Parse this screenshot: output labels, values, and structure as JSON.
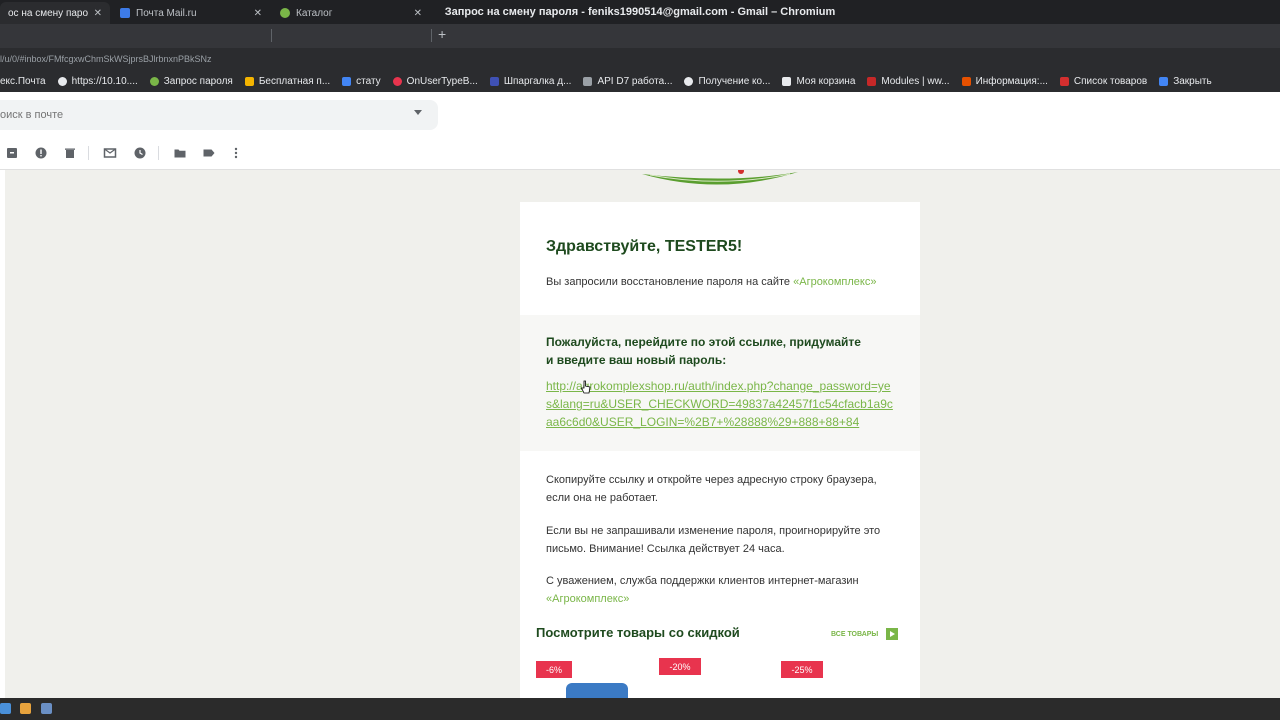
{
  "window": {
    "title": "Запрос на смену пароля - feniks1990514@gmail.com - Gmail – Chromium"
  },
  "tabs": [
    {
      "label": "ос на смену пароля",
      "close": "✕",
      "favicon_color": "#ffffff",
      "active": true
    },
    {
      "label": "Почта Mail.ru",
      "close": "✕",
      "favicon_color": "#3d7be8"
    },
    {
      "label": "Каталог",
      "close": "✕",
      "favicon_color": "#7ab648"
    }
  ],
  "new_tab_symbol": "+",
  "address": {
    "url": "l/u/0/#inbox/FMfcgxwChmSkWSjprsBJlrbnxnPBkSNz"
  },
  "bookmarks": [
    {
      "label": "екс.Почта",
      "icon_color": "#e8eaed"
    },
    {
      "label": "https://10.10....",
      "icon_color": "#e8eaed"
    },
    {
      "label": "Запрос пароля",
      "icon_color": "#7ab648"
    },
    {
      "label": "Бесплатная п...",
      "icon_color": "#f4b400"
    },
    {
      "label": "стату",
      "icon_color": "#4285f4"
    },
    {
      "label": "OnUserTypeB...",
      "icon_color": "#e8344e"
    },
    {
      "label": "Шпаргалка д...",
      "icon_color": "#3f51b5"
    },
    {
      "label": "API D7 работа...",
      "icon_color": "#9aa0a6"
    },
    {
      "label": "Получение ко...",
      "icon_color": "#e8eaed"
    },
    {
      "label": "Моя корзина",
      "icon_color": "#e8eaed"
    },
    {
      "label": "Modules | ww...",
      "icon_color": "#c62828"
    },
    {
      "label": "Информация:...",
      "icon_color": "#e65100"
    },
    {
      "label": "Список товаров",
      "icon_color": "#d32f2f"
    },
    {
      "label": "Закрыть",
      "icon_color": "#4285f4"
    }
  ],
  "search": {
    "placeholder": "оиск в почте"
  },
  "email": {
    "greeting": "Здравствуйте, TESTER5!",
    "request_text": "Вы запросили восстановление пароля на сайте ",
    "site_link": "«Агрокомплекс»",
    "instruction_line1": "Пожалуйста, перейдите по этой ссылке, придумайте",
    "instruction_line2": "и введите ваш новый пароль:",
    "reset_url": "http://agrokomplexshop.ru/auth/index.php?change_password=yes&lang=ru&USER_CHECKWORD=49837a42457f1c54cfacb1a9caa6c6d0&USER_LOGIN=%2B7+%28888%29+888+88+84",
    "copy_note_line1": "Скопируйте ссылку и откройте через адресную строку браузера,",
    "copy_note_line2": "если она не работает.",
    "ignore_line1": "Если вы не запрашивали изменение пароля, проигнорируйте это",
    "ignore_line2": "письмо. Внимание! Ссылка действует 24 часа.",
    "regards_line": "С уважением, служба поддержки клиентов интернет-магазин",
    "regards_link": "«Агрокомплекс»",
    "promo_title": "Посмотрите товары со скидкой",
    "all_goods": "ВСЕ ТОВАРЫ",
    "discounts": [
      "-6%",
      "-20%",
      "-25%"
    ]
  },
  "colors": {
    "brand_green": "#7ab648",
    "dark_green": "#1e4a1e",
    "discount_red": "#e8344e"
  }
}
